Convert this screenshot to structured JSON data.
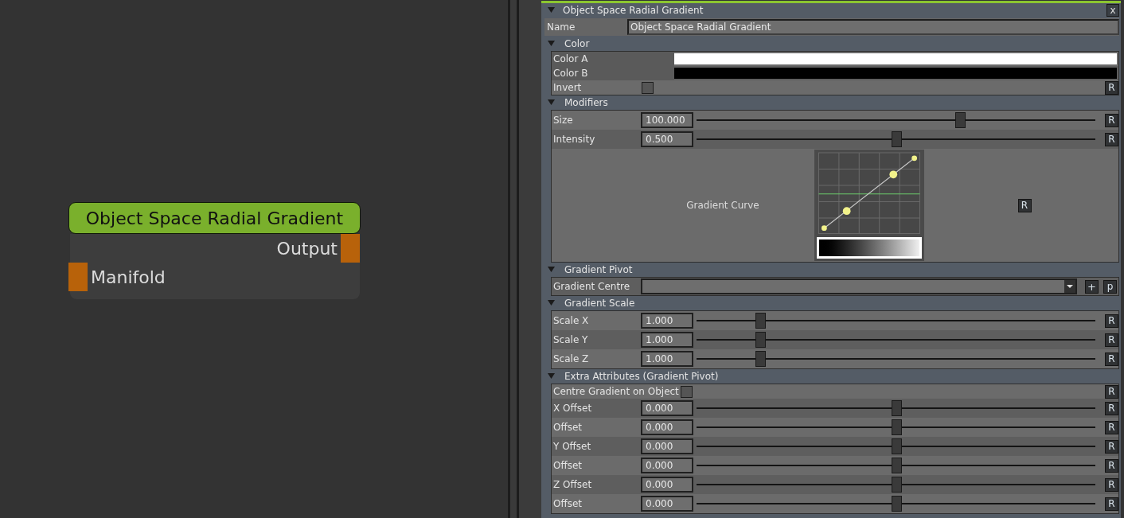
{
  "node": {
    "title": "Object Space Radial Gradient",
    "outputs": [
      {
        "label": "Output"
      }
    ],
    "inputs": [
      {
        "label": "Manifold"
      }
    ]
  },
  "panel": {
    "title": "Object Space Radial Gradient",
    "close": "x",
    "name": {
      "label": "Name",
      "value": "Object Space Radial Gradient"
    },
    "sections": [
      {
        "title": "Color",
        "expanded": true,
        "rows": [
          {
            "kind": "color",
            "label": "Color A",
            "color": "#ffffff"
          },
          {
            "kind": "color",
            "label": "Color B",
            "color": "#000000"
          },
          {
            "kind": "checkbox",
            "label": "Invert",
            "checked": false,
            "reset": "R"
          }
        ]
      },
      {
        "title": "Modifiers",
        "expanded": true,
        "rows": [
          {
            "kind": "slider",
            "label": "Size",
            "value": "100.000",
            "level": 0.66,
            "reset": "R"
          },
          {
            "kind": "slider",
            "label": "Intensity",
            "value": "0.500",
            "level": 0.5,
            "reset": "R"
          },
          {
            "kind": "curve",
            "label": "Gradient Curve",
            "reset": "R"
          }
        ]
      },
      {
        "title": "Gradient Pivot",
        "expanded": true,
        "rows": [
          {
            "kind": "dropdown",
            "label": "Gradient Centre",
            "add": "+",
            "pick": "p"
          }
        ]
      },
      {
        "title": "Gradient Scale",
        "expanded": true,
        "rows": [
          {
            "kind": "slider",
            "label": "Scale X",
            "value": "1.000",
            "level": 0.16,
            "reset": "R"
          },
          {
            "kind": "slider",
            "label": "Scale Y",
            "value": "1.000",
            "level": 0.16,
            "reset": "R"
          },
          {
            "kind": "slider",
            "label": "Scale Z",
            "value": "1.000",
            "level": 0.16,
            "reset": "R"
          }
        ]
      },
      {
        "title": "Extra Attributes (Gradient Pivot)",
        "expanded": true,
        "rows": [
          {
            "kind": "checkbox",
            "label": "Centre Gradient on Object",
            "checked": false,
            "reset": "R"
          },
          {
            "kind": "slider",
            "label": "X Offset",
            "value": "0.000",
            "level": 0.5,
            "reset": "R"
          },
          {
            "kind": "slider",
            "label": "Offset",
            "value": "0.000",
            "level": 0.5,
            "reset": "R"
          },
          {
            "kind": "slider",
            "label": "Y Offset",
            "value": "0.000",
            "level": 0.5,
            "reset": "R"
          },
          {
            "kind": "slider",
            "label": "Offset",
            "value": "0.000",
            "level": 0.5,
            "reset": "R"
          },
          {
            "kind": "slider",
            "label": "Z Offset",
            "value": "0.000",
            "level": 0.5,
            "reset": "R"
          },
          {
            "kind": "slider",
            "label": "Offset",
            "value": "0.000",
            "level": 0.5,
            "reset": "R"
          }
        ]
      }
    ]
  }
}
